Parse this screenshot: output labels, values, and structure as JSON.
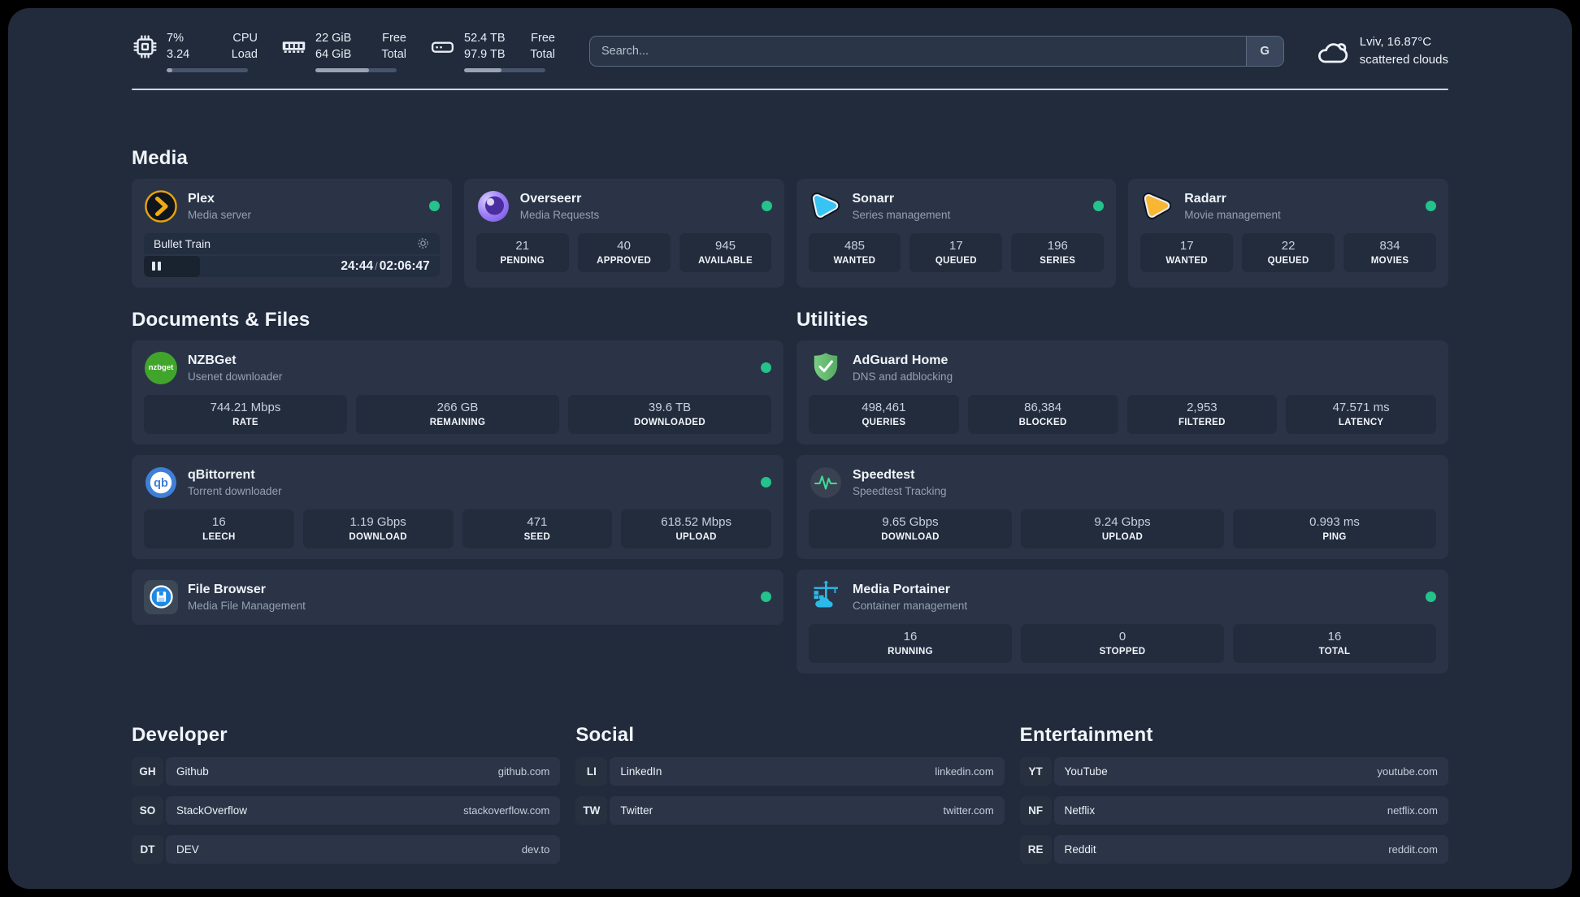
{
  "header": {
    "stats": [
      {
        "icon": "cpu",
        "line1": "7%",
        "line2": "3.24",
        "label1": "CPU",
        "label2": "Load",
        "percent": 7
      },
      {
        "icon": "ram",
        "line1": "22 GiB",
        "line2": "64 GiB",
        "label1": "Free",
        "label2": "Total",
        "percent": 66
      },
      {
        "icon": "disk",
        "line1": "52.4 TB",
        "line2": "97.9 TB",
        "label1": "Free",
        "label2": "Total",
        "percent": 46
      }
    ],
    "search": {
      "placeholder": "Search...",
      "button": "G"
    },
    "weather": {
      "location_temp": "Lviv, 16.87°C",
      "description": "scattered clouds"
    }
  },
  "sections": {
    "media": {
      "title": "Media",
      "cards": [
        {
          "name": "Plex",
          "subtitle": "Media server",
          "player": {
            "title": "Bullet Train",
            "current": "24:44",
            "separator": "/",
            "total": "02:06:47",
            "progress_percent": 19
          }
        },
        {
          "name": "Overseerr",
          "subtitle": "Media Requests",
          "stats": [
            {
              "value": "21",
              "label": "PENDING"
            },
            {
              "value": "40",
              "label": "APPROVED"
            },
            {
              "value": "945",
              "label": "AVAILABLE"
            }
          ]
        },
        {
          "name": "Sonarr",
          "subtitle": "Series management",
          "stats": [
            {
              "value": "485",
              "label": "WANTED"
            },
            {
              "value": "17",
              "label": "QUEUED"
            },
            {
              "value": "196",
              "label": "SERIES"
            }
          ]
        },
        {
          "name": "Radarr",
          "subtitle": "Movie management",
          "stats": [
            {
              "value": "17",
              "label": "WANTED"
            },
            {
              "value": "22",
              "label": "QUEUED"
            },
            {
              "value": "834",
              "label": "MOVIES"
            }
          ]
        }
      ]
    },
    "documents": {
      "title": "Documents & Files",
      "cards": [
        {
          "name": "NZBGet",
          "subtitle": "Usenet downloader",
          "badge": "nzbget",
          "stats": [
            {
              "value": "744.21 Mbps",
              "label": "RATE"
            },
            {
              "value": "266 GB",
              "label": "REMAINING"
            },
            {
              "value": "39.6 TB",
              "label": "DOWNLOADED"
            }
          ]
        },
        {
          "name": "qBittorrent",
          "subtitle": "Torrent downloader",
          "badge": "qb",
          "stats": [
            {
              "value": "16",
              "label": "LEECH"
            },
            {
              "value": "1.19 Gbps",
              "label": "DOWNLOAD"
            },
            {
              "value": "471",
              "label": "SEED"
            },
            {
              "value": "618.52 Mbps",
              "label": "UPLOAD"
            }
          ]
        },
        {
          "name": "File Browser",
          "subtitle": "Media File Management"
        }
      ]
    },
    "utilities": {
      "title": "Utilities",
      "cards": [
        {
          "name": "AdGuard Home",
          "subtitle": "DNS and adblocking",
          "stats": [
            {
              "value": "498,461",
              "label": "QUERIES"
            },
            {
              "value": "86,384",
              "label": "BLOCKED"
            },
            {
              "value": "2,953",
              "label": "FILTERED"
            },
            {
              "value": "47.571 ms",
              "label": "LATENCY"
            }
          ]
        },
        {
          "name": "Speedtest",
          "subtitle": "Speedtest Tracking",
          "stats": [
            {
              "value": "9.65 Gbps",
              "label": "DOWNLOAD"
            },
            {
              "value": "9.24 Gbps",
              "label": "UPLOAD"
            },
            {
              "value": "0.993 ms",
              "label": "PING"
            }
          ]
        },
        {
          "name": "Media Portainer",
          "subtitle": "Container management",
          "stats": [
            {
              "value": "16",
              "label": "RUNNING"
            },
            {
              "value": "0",
              "label": "STOPPED"
            },
            {
              "value": "16",
              "label": "TOTAL"
            }
          ]
        }
      ]
    },
    "links": [
      {
        "title": "Developer",
        "items": [
          {
            "abbr": "GH",
            "name": "Github",
            "url": "github.com"
          },
          {
            "abbr": "SO",
            "name": "StackOverflow",
            "url": "stackoverflow.com"
          },
          {
            "abbr": "DT",
            "name": "DEV",
            "url": "dev.to"
          }
        ]
      },
      {
        "title": "Social",
        "items": [
          {
            "abbr": "LI",
            "name": "LinkedIn",
            "url": "linkedin.com"
          },
          {
            "abbr": "TW",
            "name": "Twitter",
            "url": "twitter.com"
          }
        ]
      },
      {
        "title": "Entertainment",
        "items": [
          {
            "abbr": "YT",
            "name": "YouTube",
            "url": "youtube.com"
          },
          {
            "abbr": "NF",
            "name": "Netflix",
            "url": "netflix.com"
          },
          {
            "abbr": "RE",
            "name": "Reddit",
            "url": "reddit.com"
          }
        ]
      }
    ]
  },
  "colors": {
    "online": "#23c38b",
    "page_bg": "#212b3c",
    "card_bg": "#2a3446",
    "stat_bg": "#222c3d"
  }
}
